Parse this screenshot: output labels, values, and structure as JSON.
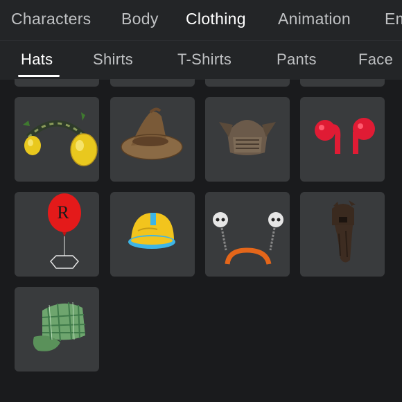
{
  "top_nav": {
    "tabs": [
      {
        "label": "Characters"
      },
      {
        "label": "Body"
      },
      {
        "label": "Clothing",
        "active": true
      },
      {
        "label": "Animation"
      },
      {
        "label": "Em"
      }
    ]
  },
  "sub_nav": {
    "tabs": [
      {
        "label": "Hats",
        "active": true
      },
      {
        "label": "Shirts"
      },
      {
        "label": "T-Shirts"
      },
      {
        "label": "Pants"
      },
      {
        "label": "Face"
      }
    ]
  },
  "grid": {
    "items": [
      {
        "icon": "lemon-headphones-icon"
      },
      {
        "icon": "witch-hat-icon"
      },
      {
        "icon": "cat-ear-hood-icon"
      },
      {
        "icon": "red-ear-tufts-icon"
      },
      {
        "icon": "red-balloon-icon",
        "balloon_letter": "R"
      },
      {
        "icon": "hard-hat-icon"
      },
      {
        "icon": "skull-headband-icon"
      },
      {
        "icon": "bear-hood-icon"
      },
      {
        "icon": "plaid-cap-icon"
      }
    ]
  },
  "colors": {
    "background": "#1a1b1d",
    "nav_background": "#232527",
    "tile_background": "#393b3d",
    "active_text": "#ffffff",
    "inactive_text": "#bfc1c3"
  }
}
